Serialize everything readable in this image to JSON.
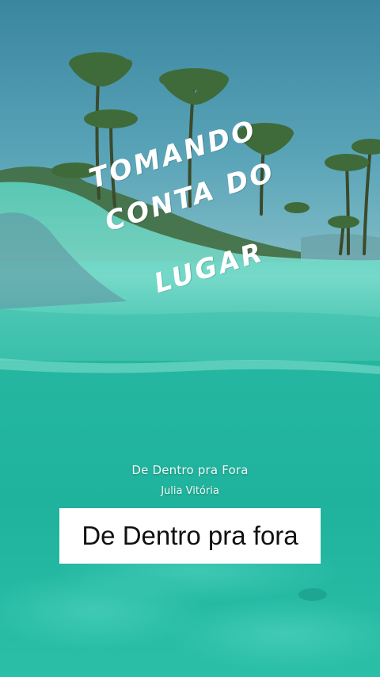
{
  "headline": {
    "line1": "TOMANDO",
    "line2": "CONTA DO",
    "line3": "LUGAR"
  },
  "music": {
    "title": "De Dentro pra Fora",
    "artist": "Julia Vitória"
  },
  "caption": {
    "text": "De Dentro pra fora"
  },
  "colors": {
    "sky": "#3f8fa6",
    "water": "#1fb9a3",
    "caption_bg": "#ffffff",
    "caption_text": "#111111"
  }
}
